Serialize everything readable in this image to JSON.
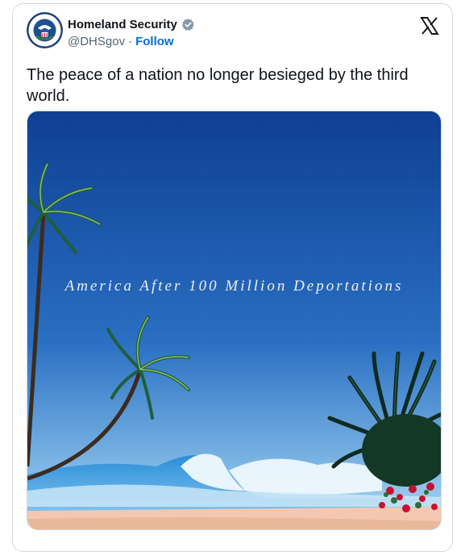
{
  "account": {
    "display_name": "Homeland Security",
    "handle": "@DHSgov",
    "separator": "·",
    "follow_label": "Follow",
    "verified_color": "#829aab"
  },
  "tweet": {
    "text": "The peace of a nation no longer besieged by the third world."
  },
  "media": {
    "caption": "America After 100 Million Deportations"
  },
  "colors": {
    "follow": "#006fd6",
    "sky_top": "#0e3f92",
    "sky_bottom": "#7fb8e6"
  }
}
